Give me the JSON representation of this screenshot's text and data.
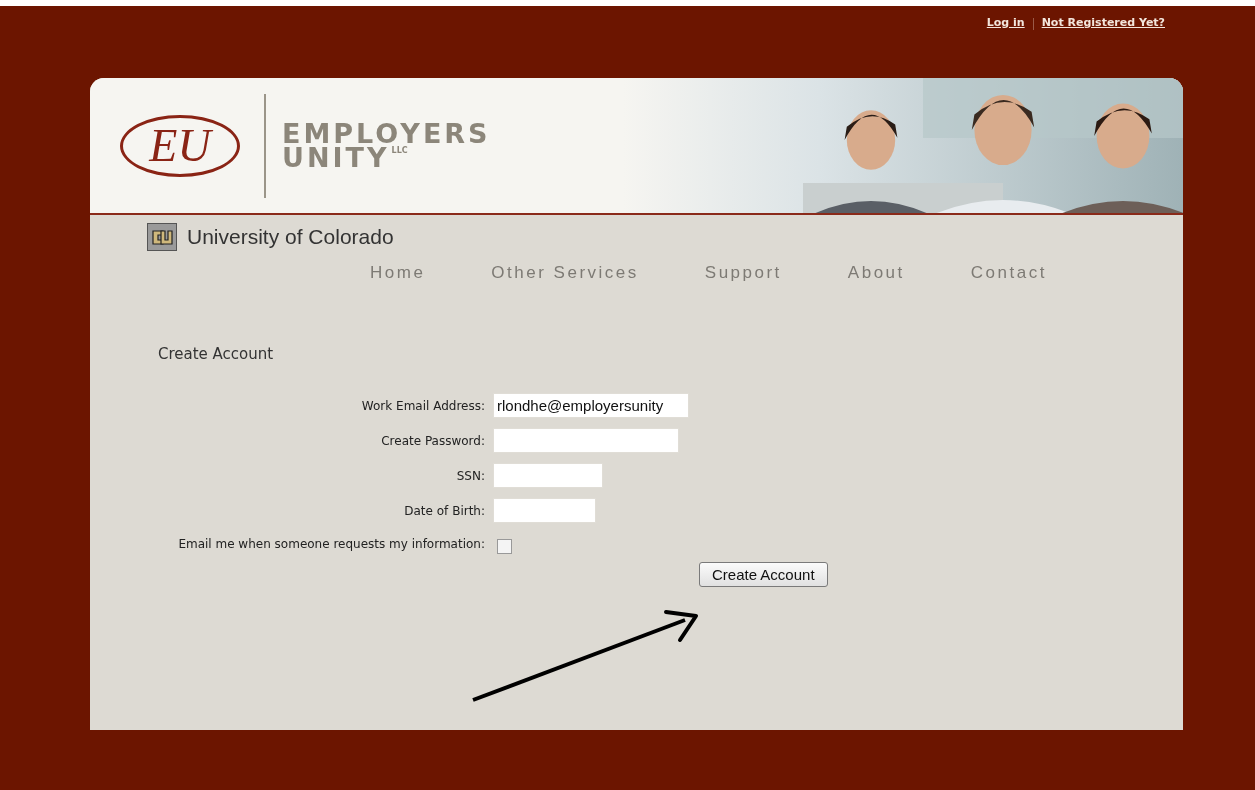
{
  "top_links": [
    {
      "label": "Log in"
    },
    {
      "label": "Not Registered Yet?"
    }
  ],
  "logo": {
    "monogram": "EU",
    "name_line1": "EMPLOYERS",
    "name_line2": "UNITY",
    "suffix": "LLC"
  },
  "school": {
    "name": "University of Colorado"
  },
  "nav": [
    {
      "label": "Home"
    },
    {
      "label": "Other Services"
    },
    {
      "label": "Support"
    },
    {
      "label": "About"
    },
    {
      "label": "Contact"
    }
  ],
  "form": {
    "title": "Create Account",
    "fields": [
      {
        "kind": "text",
        "label": "Work Email Address:",
        "value": "rlondhe@employersunity"
      },
      {
        "kind": "text",
        "label": "Create Password:"
      },
      {
        "kind": "text",
        "label": "SSN:"
      },
      {
        "kind": "text",
        "label": "Date of Birth:"
      },
      {
        "kind": "checkbox",
        "label": "Email me when someone requests my information:",
        "checked": false
      }
    ],
    "submit": "Create Account"
  }
}
